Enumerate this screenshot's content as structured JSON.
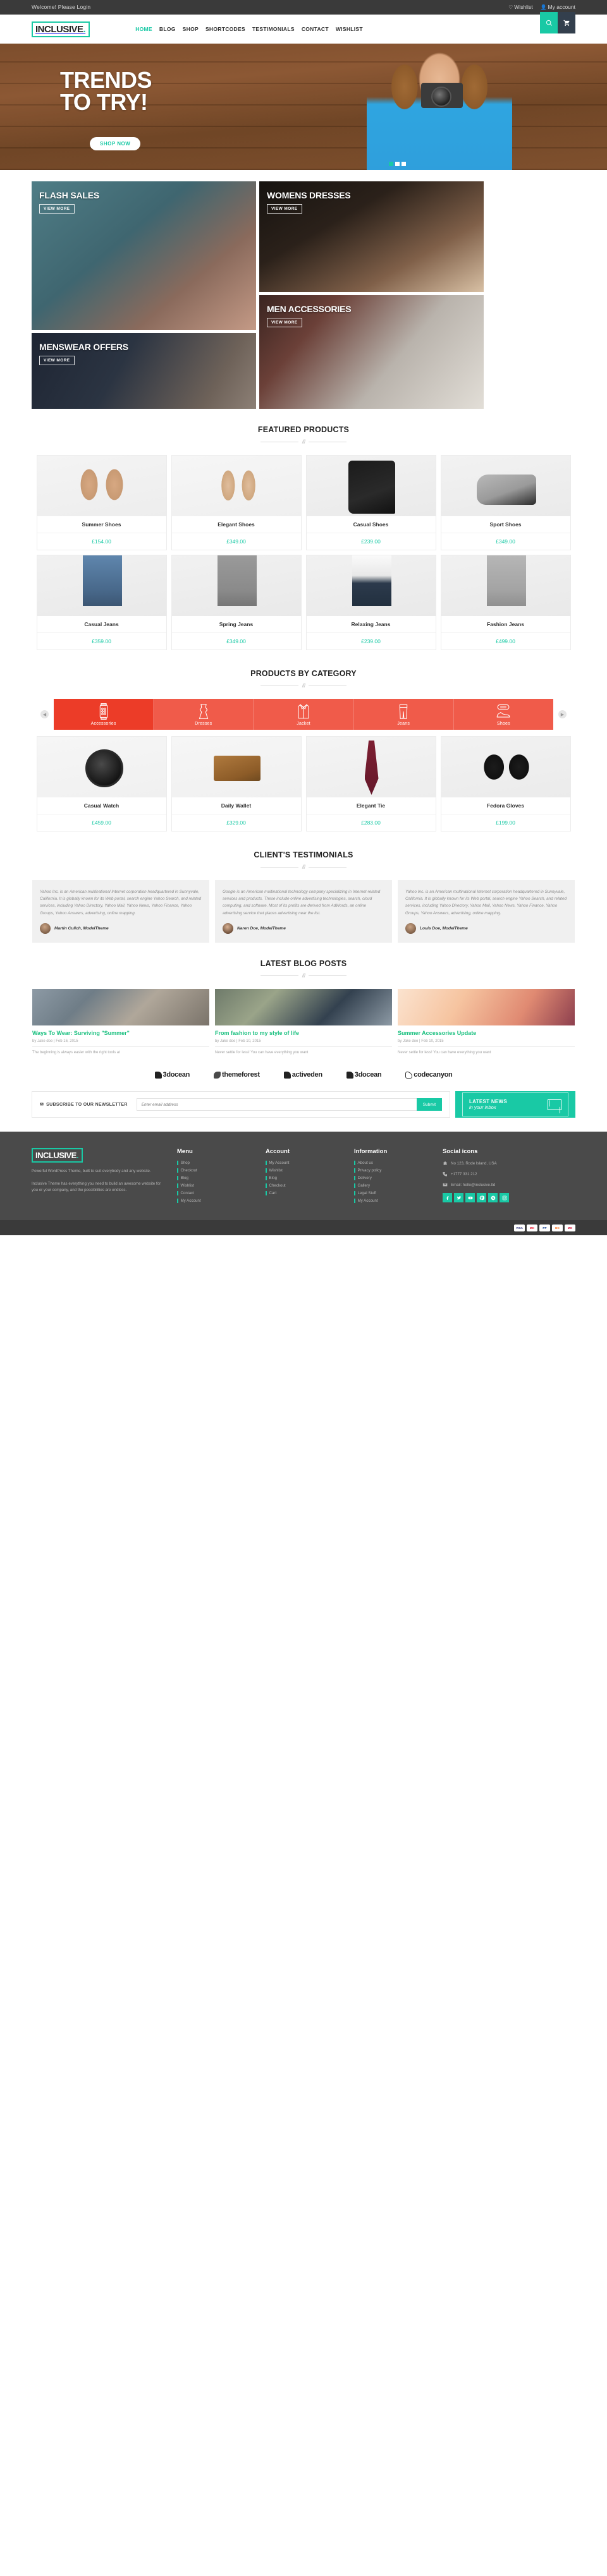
{
  "topbar": {
    "welcome": "Welcome! Please Login",
    "wishlist": "Wishlist",
    "account": "My account"
  },
  "header": {
    "logo": "INCLUSIVE",
    "logo_dot": ".",
    "nav": [
      {
        "label": "HOME",
        "active": true
      },
      {
        "label": "BLOG",
        "active": false
      },
      {
        "label": "SHOP",
        "active": false
      },
      {
        "label": "SHORTCODES",
        "active": false
      },
      {
        "label": "TESTIMONIALS",
        "active": false
      },
      {
        "label": "CONTACT",
        "active": false
      },
      {
        "label": "WISHLIST",
        "active": false
      }
    ]
  },
  "hero": {
    "line1": "TRENDS",
    "line2": "TO TRY!",
    "button": "SHOP NOW"
  },
  "category_tiles": [
    {
      "title": "FLASH SALES",
      "button": "VIEW MORE"
    },
    {
      "title": "MENSWEAR OFFERS",
      "button": "VIEW MORE"
    },
    {
      "title": "WOMENS DRESSES",
      "button": "VIEW MORE"
    },
    {
      "title": "MEN ACCESSORIES",
      "button": "VIEW MORE"
    }
  ],
  "featured": {
    "title": "FEATURED PRODUCTS",
    "row1": [
      {
        "name": "Summer Shoes",
        "price": "£154.00"
      },
      {
        "name": "Elegant Shoes",
        "price": "£349.00"
      },
      {
        "name": "Casual Shoes",
        "price": "£239.00"
      },
      {
        "name": "Sport Shoes",
        "price": "£349.00"
      }
    ],
    "row2": [
      {
        "name": "Casual Jeans",
        "price": "£359.00"
      },
      {
        "name": "Spring Jeans",
        "price": "£349.00"
      },
      {
        "name": "Relaxing Jeans",
        "price": "£239.00"
      },
      {
        "name": "Fashion Jeans",
        "price": "£499.00"
      }
    ]
  },
  "by_category": {
    "title": "PRODUCTS BY CATEGORY",
    "tabs": [
      {
        "label": "Accessories",
        "icon": "watch-icon",
        "active": true
      },
      {
        "label": "Dresses",
        "icon": "dress-icon",
        "active": false
      },
      {
        "label": "Jacket",
        "icon": "jacket-icon",
        "active": false
      },
      {
        "label": "Jeans",
        "icon": "jeans-icon",
        "active": false
      },
      {
        "label": "Shoes",
        "icon": "shoe-icon",
        "active": false
      }
    ],
    "products": [
      {
        "name": "Casual Watch",
        "price": "£459.00"
      },
      {
        "name": "Daily Wallet",
        "price": "£329.00"
      },
      {
        "name": "Elegant Tie",
        "price": "£283.00"
      },
      {
        "name": "Fedora Gloves",
        "price": "£199.00"
      }
    ]
  },
  "testimonials": {
    "title": "CLIENT'S TESTIMONIALS",
    "items": [
      {
        "quote": "Yahoo Inc. is an American multinational Internet corporation headquartered in Sunnyvale, California. It is globally known for its Web portal, search engine Yahoo Search, and related services, including Yahoo Directory, Yahoo Mail, Yahoo News, Yahoo Finance, Yahoo Groups, Yahoo Answers, advertising, online mapping.",
        "author": "Martin Culich, ModelTheme"
      },
      {
        "quote": "Google is an American multinational technology company specializing in Internet-related services and products. These include online advertising technologies, search, cloud computing, and software. Most of its profits are derived from AdWords, an online advertising service that places advertising near the list.",
        "author": "Naren Doe, ModelTheme"
      },
      {
        "quote": "Yahoo Inc. is an American multinational Internet corporation headquartered in Sunnyvale, California. It is globally known for its Web portal, search engine Yahoo Search, and related services, including Yahoo Directory, Yahoo Mail, Yahoo News, Yahoo Finance, Yahoo Groups, Yahoo Answers, advertising, online mapping.",
        "author": "Louis Doe, ModelTheme"
      }
    ]
  },
  "blog": {
    "title": "LATEST BLOG POSTS",
    "posts": [
      {
        "title": "Ways To Wear: Surviving \"Summer\"",
        "meta": "by Jake doe | Feb 16, 2015",
        "excerpt": "The beginning is always easier with the right tools at"
      },
      {
        "title": "From fashion to my style of life",
        "meta": "by Jake doe | Feb 10, 2015",
        "excerpt": "Never settle for less! You can have everything you want"
      },
      {
        "title": "Summer Accessories Update",
        "meta": "by Jake doe | Feb 10, 2015",
        "excerpt": "Never settle for less! You can have everything you want"
      }
    ]
  },
  "brands": [
    {
      "name": "3docean",
      "mark": "3d"
    },
    {
      "name": "themeforest",
      "mark": "tf"
    },
    {
      "name": "activeden",
      "mark": "ad"
    },
    {
      "name": "3docean",
      "mark": "3d"
    },
    {
      "name": "codecanyon",
      "mark": "cc"
    }
  ],
  "newsletter": {
    "label": "SUBSCRIBE TO OUR NEWSLETTER",
    "placeholder": "Enter email address",
    "submit": "Submit",
    "promo_line1": "LATEST NEWS",
    "promo_line2": "in your inbox"
  },
  "footer": {
    "logo": "INCLUSIVE",
    "logo_dot": ".",
    "about_p1": "Powerful WordPress Theme, built to suit everybody and any website.",
    "about_p2": "Inclusive Theme has everything you need to build an awesome website for you or your company, and the possibilities are endless.",
    "menu": {
      "heading": "Menu",
      "links": [
        "Shop",
        "Checkout",
        "Blog",
        "Wishlist",
        "Contact",
        "My Account"
      ]
    },
    "account": {
      "heading": "Account",
      "links": [
        "My Account",
        "Wishlist",
        "Blog",
        "Checkout",
        "Cart"
      ]
    },
    "information": {
      "heading": "Information",
      "links": [
        "About us",
        "Privacy policy",
        "Delivery",
        "Gallery",
        "Legal Stuff",
        "My Account"
      ]
    },
    "social": {
      "heading": "Social icons",
      "address": "No 123, Rode Island, USA",
      "phone": "+1777 331 212",
      "email": "Email: hello@inclusive.tld",
      "icons": [
        "facebook-icon",
        "twitter-icon",
        "youtube-icon",
        "pinterest-icon",
        "skype-icon",
        "instagram-icon"
      ]
    }
  },
  "payments": [
    "VISA",
    "MC",
    "PP",
    "DC",
    "MO"
  ],
  "colors": {
    "accent": "#19c9a5",
    "category_red": "#ec3c28",
    "blog_green": "#19c07f",
    "dark": "#3a3a3a",
    "footer": "#4a4a4a"
  }
}
